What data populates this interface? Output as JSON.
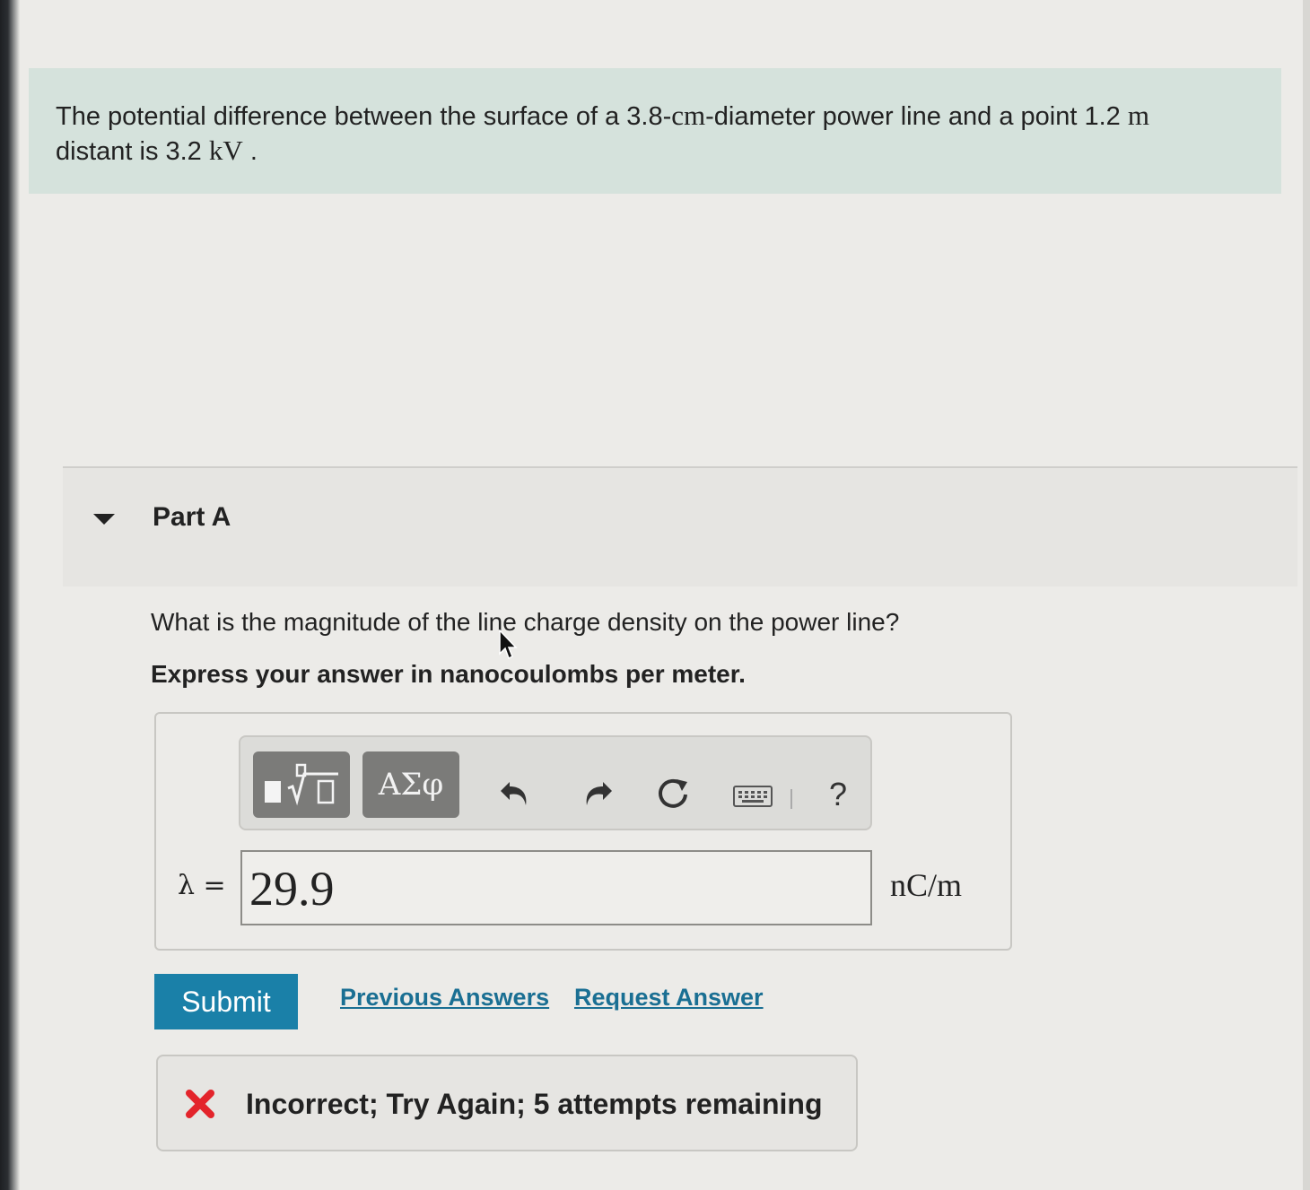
{
  "intro": {
    "line1_pre": "The potential difference between the surface of a 3.8-",
    "line1_unit1": "cm",
    "line1_mid": "-diameter power line and a point 1.2 ",
    "line1_unit2": "m",
    "line2_pre": "distant is 3.2 ",
    "line2_unit": "kV",
    "line2_post": " ."
  },
  "part": {
    "title": "Part A",
    "question": "What is the magnitude of the line charge density on the power line?",
    "instruction": "Express your answer in nanocoulombs per meter."
  },
  "toolbar": {
    "symbols_label": "ΑΣφ",
    "help_label": "?",
    "icons": [
      "templates-icon",
      "greek-symbols-icon",
      "undo-icon",
      "redo-icon",
      "reset-icon",
      "keyboard-icon",
      "help-icon"
    ]
  },
  "answer": {
    "variable_label": "λ =",
    "value": "29.9",
    "unit": "nC/m"
  },
  "actions": {
    "submit_label": "Submit",
    "previous_answers_label": "Previous Answers",
    "request_answer_label": "Request Answer"
  },
  "feedback": {
    "message": "Incorrect; Try Again; 5 attempts remaining",
    "status": "incorrect"
  },
  "colors": {
    "intro_bg": "#d5e2dc",
    "submit_bg": "#1a80a8",
    "link": "#1a6f93",
    "error": "#e3242b"
  }
}
